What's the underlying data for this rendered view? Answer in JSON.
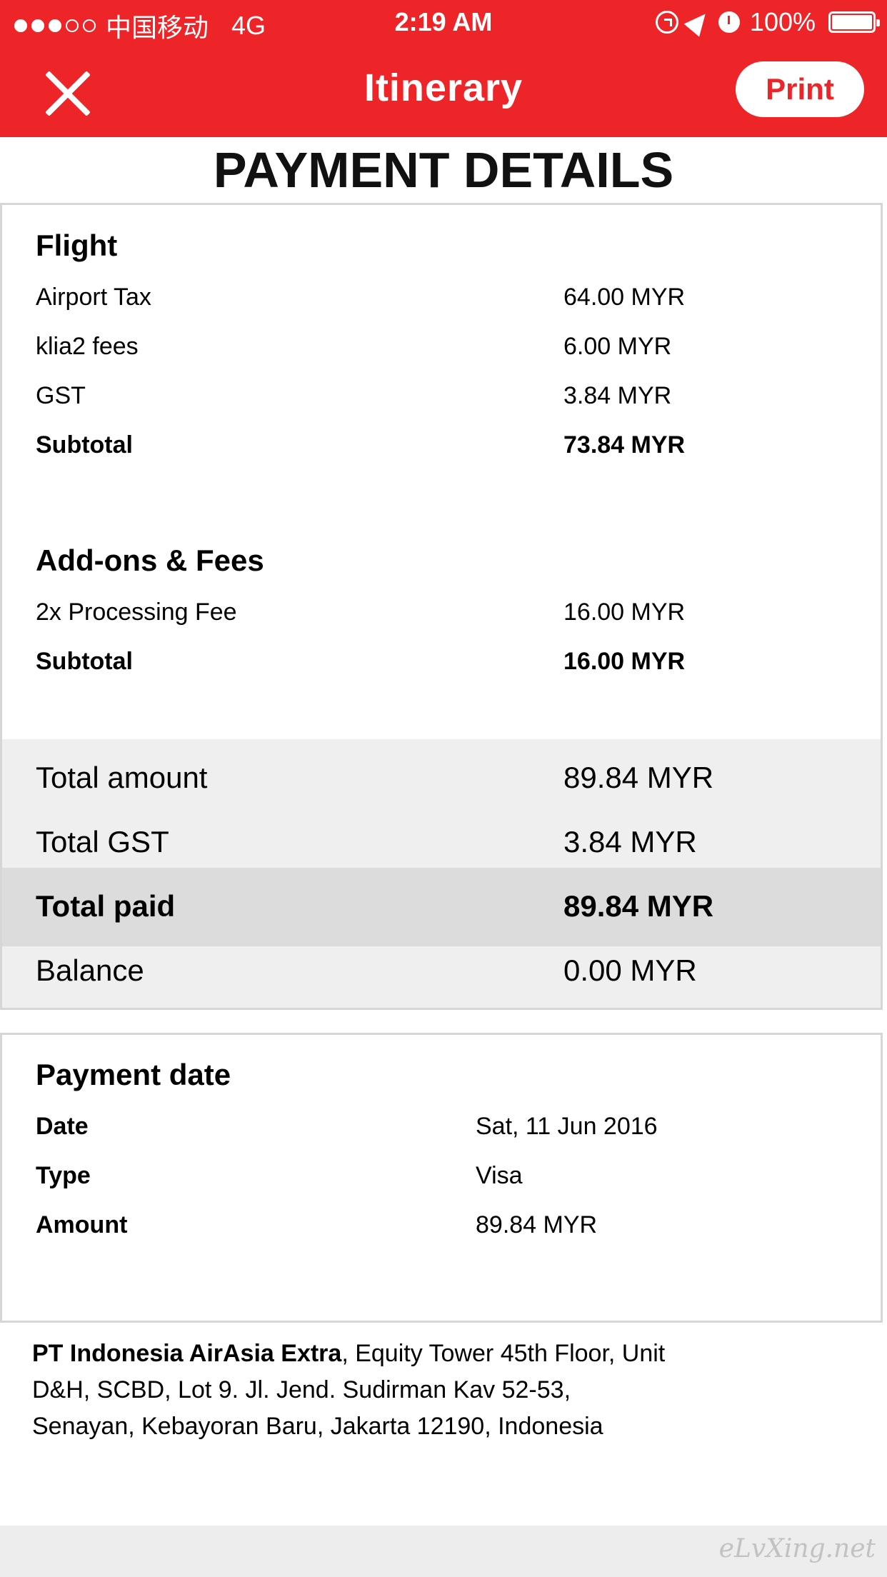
{
  "status_bar": {
    "carrier": "中国移动",
    "network": "4G",
    "time": "2:19 AM",
    "battery": "100%",
    "signal_filled": 3,
    "signal_total": 5
  },
  "nav": {
    "title": "Itinerary",
    "print_label": "Print"
  },
  "page_title": "PAYMENT DETAILS",
  "flight": {
    "title": "Flight",
    "rows": [
      {
        "label": "Airport Tax",
        "value": "64.00 MYR"
      },
      {
        "label": "klia2 fees",
        "value": "6.00 MYR"
      },
      {
        "label": "GST",
        "value": "3.84 MYR"
      }
    ],
    "subtotal_label": "Subtotal",
    "subtotal_value": "73.84 MYR"
  },
  "addons": {
    "title": "Add-ons & Fees",
    "rows": [
      {
        "label": "2x Processing Fee",
        "value": "16.00 MYR"
      }
    ],
    "subtotal_label": "Subtotal",
    "subtotal_value": "16.00 MYR"
  },
  "totals": {
    "total_amount_label": "Total amount",
    "total_amount_value": "89.84 MYR",
    "total_gst_label": "Total GST",
    "total_gst_value": "3.84 MYR",
    "total_paid_label": "Total paid",
    "total_paid_value": "89.84 MYR",
    "balance_label": "Balance",
    "balance_value": "0.00 MYR"
  },
  "payment": {
    "title": "Payment date",
    "rows": [
      {
        "label": "Date",
        "value": "Sat, 11 Jun 2016"
      },
      {
        "label": "Type",
        "value": "Visa"
      },
      {
        "label": "Amount",
        "value": "89.84 MYR"
      }
    ]
  },
  "address": {
    "company": "PT Indonesia AirAsia Extra",
    "line": ", Equity Tower 45th Floor, Unit D&H, SCBD, Lot 9. Jl. Jend. Sudirman Kav 52-53, Senayan, Kebayoran Baru, Jakarta 12190, Indonesia"
  },
  "watermark": "eLvXing.net",
  "colors": {
    "brand_red": "#ed2529",
    "summary_bg": "#efefef",
    "total_paid_bg": "#dcdcdc"
  }
}
